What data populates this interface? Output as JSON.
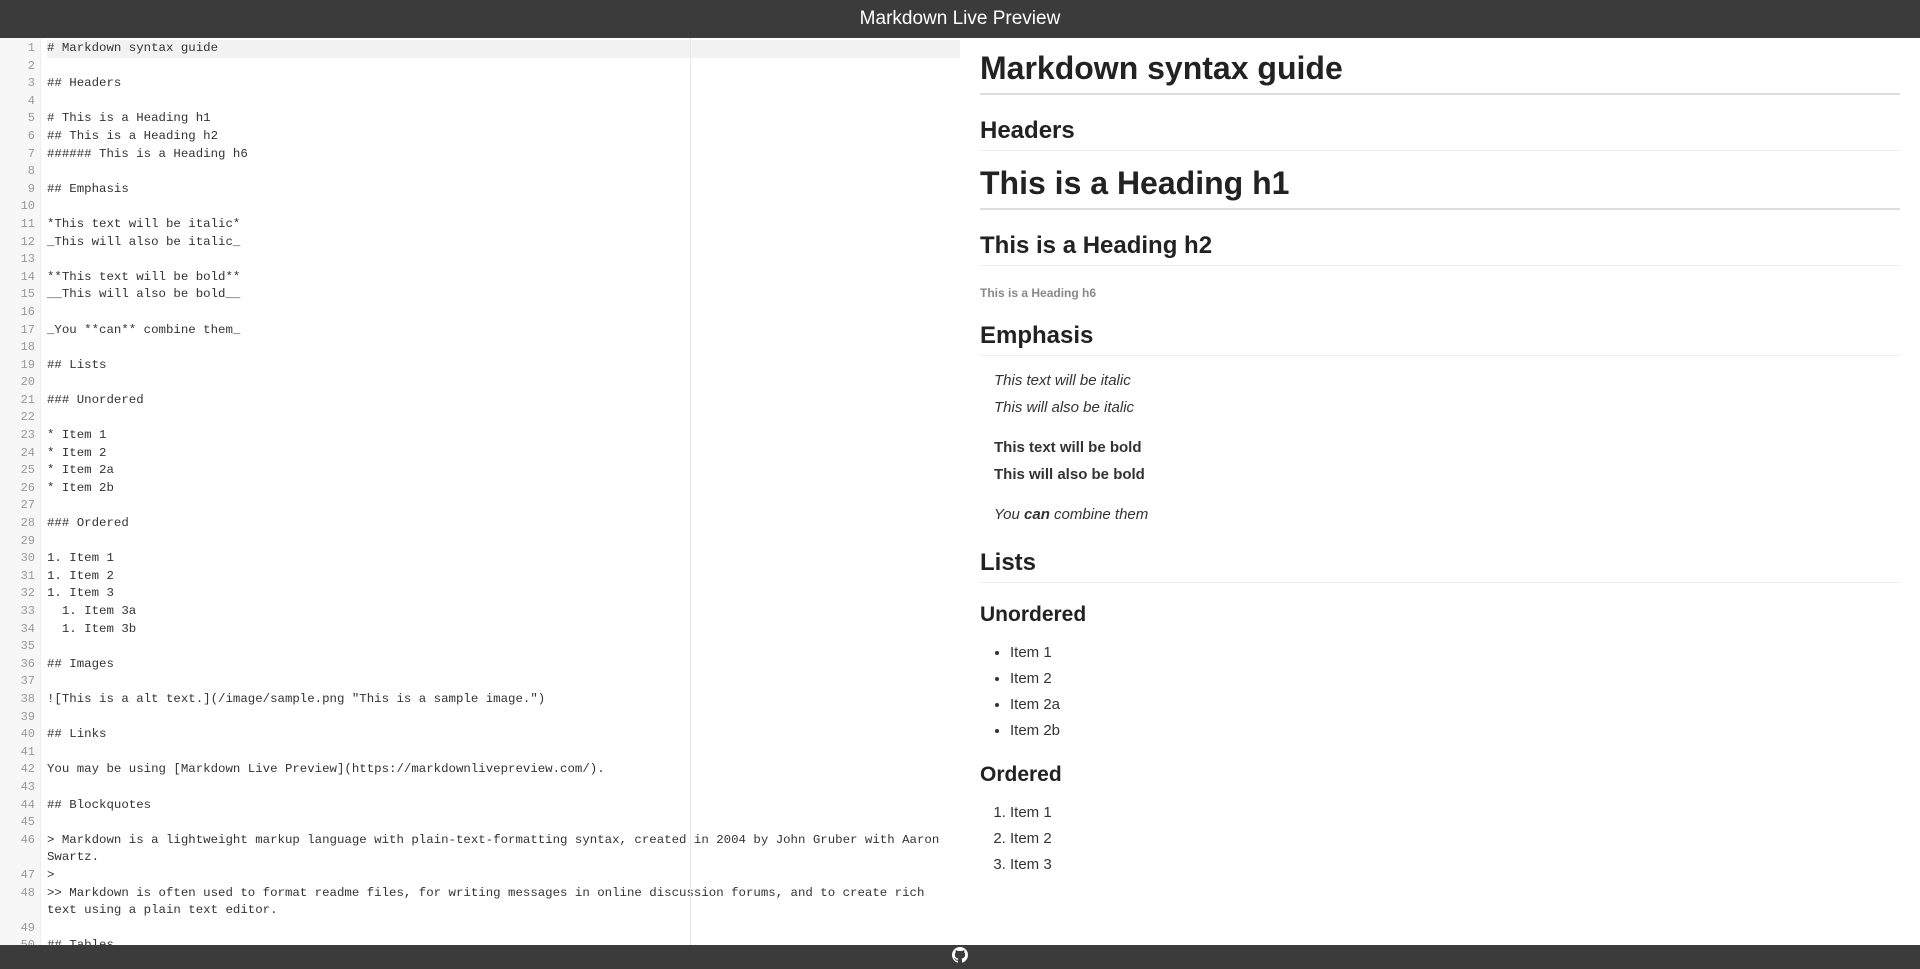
{
  "header": {
    "title": "Markdown Live Preview"
  },
  "footer": {
    "icon": "github-icon"
  },
  "editor": {
    "active_line": 1,
    "lines": [
      "# Markdown syntax guide",
      "",
      "## Headers",
      "",
      "# This is a Heading h1",
      "## This is a Heading h2",
      "###### This is a Heading h6",
      "",
      "## Emphasis",
      "",
      "*This text will be italic*",
      "_This will also be italic_",
      "",
      "**This text will be bold**",
      "__This will also be bold__",
      "",
      "_You **can** combine them_",
      "",
      "## Lists",
      "",
      "### Unordered",
      "",
      "* Item 1",
      "* Item 2",
      "* Item 2a",
      "* Item 2b",
      "",
      "### Ordered",
      "",
      "1. Item 1",
      "1. Item 2",
      "1. Item 3",
      "  1. Item 3a",
      "  1. Item 3b",
      "",
      "## Images",
      "",
      "![This is a alt text.](/image/sample.png \"This is a sample image.\")",
      "",
      "## Links",
      "",
      "You may be using [Markdown Live Preview](https://markdownlivepreview.com/).",
      "",
      "## Blockquotes",
      "",
      "> Markdown is a lightweight markup language with plain-text-formatting syntax, created in 2004 by John Gruber with Aaron Swartz.",
      ">",
      ">> Markdown is often used to format readme files, for writing messages in online discussion forums, and to create rich text using a plain text editor.",
      "",
      "## Tables"
    ]
  },
  "preview": {
    "h1_main": "Markdown syntax guide",
    "h2_headers": "Headers",
    "h1_heading": "This is a Heading h1",
    "h2_heading": "This is a Heading h2",
    "h6_heading": "This is a Heading h6",
    "h2_emphasis": "Emphasis",
    "em1": "This text will be italic",
    "em2": "This will also be italic",
    "b1": "This text will be bold",
    "b2": "This will also be bold",
    "combine_pre": "You ",
    "combine_bold": "can",
    "combine_post": " combine them",
    "h2_lists": "Lists",
    "h3_unordered": "Unordered",
    "ul": [
      "Item 1",
      "Item 2",
      "Item 2a",
      "Item 2b"
    ],
    "h3_ordered": "Ordered",
    "ol": [
      "Item 1",
      "Item 2",
      "Item 3"
    ]
  }
}
